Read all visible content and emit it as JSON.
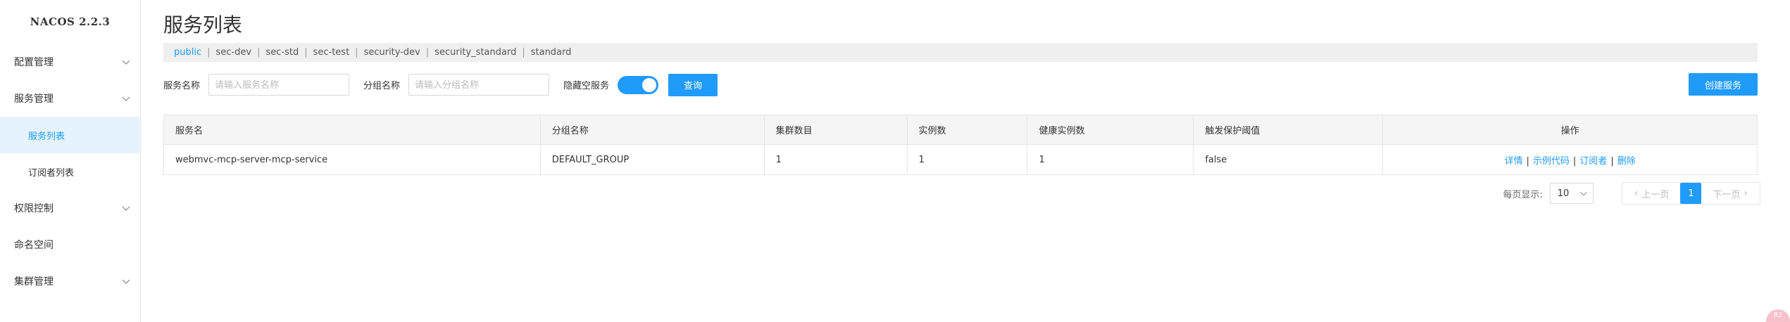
{
  "app": {
    "brand": "NACOS 2.2.3"
  },
  "sidebar": {
    "items": [
      {
        "label": "配置管理",
        "expandable": true
      },
      {
        "label": "服务管理",
        "expandable": true
      },
      {
        "label": "服务列表",
        "sub": true,
        "active": true
      },
      {
        "label": "订阅者列表",
        "sub": true
      },
      {
        "label": "权限控制",
        "expandable": true
      },
      {
        "label": "命名空间"
      },
      {
        "label": "集群管理",
        "expandable": true
      }
    ]
  },
  "page": {
    "title": "服务列表"
  },
  "namespaces": {
    "items": [
      "public",
      "sec-dev",
      "sec-std",
      "sec-test",
      "security-dev",
      "security_standard",
      "standard"
    ],
    "active": "public",
    "separator": "|"
  },
  "filters": {
    "service_name_label": "服务名称",
    "service_name_placeholder": "请输入服务名称",
    "group_name_label": "分组名称",
    "group_name_placeholder": "请输入分组名称",
    "hide_empty_label": "隐藏空服务",
    "hide_empty_enabled": true,
    "query_label": "查询",
    "create_label": "创建服务"
  },
  "table": {
    "headers": [
      "服务名",
      "分组名称",
      "集群数目",
      "实例数",
      "健康实例数",
      "触发保护阈值",
      "操作"
    ],
    "rows": [
      {
        "service": "webmvc-mcp-server-mcp-service",
        "group": "DEFAULT_GROUP",
        "clusters": "1",
        "instances": "1",
        "healthy": "1",
        "threshold": "false",
        "ops": [
          "详情",
          "示例代码",
          "订阅者",
          "删除"
        ]
      }
    ]
  },
  "pagination": {
    "per_page_label": "每页显示:",
    "per_page_value": "10",
    "prev_label": "上一页",
    "next_label": "下一页",
    "current_page": "1"
  },
  "colors": {
    "accent": "#209bfa",
    "active_bg": "#e5f3ff"
  },
  "badge": {
    "text": "82"
  }
}
